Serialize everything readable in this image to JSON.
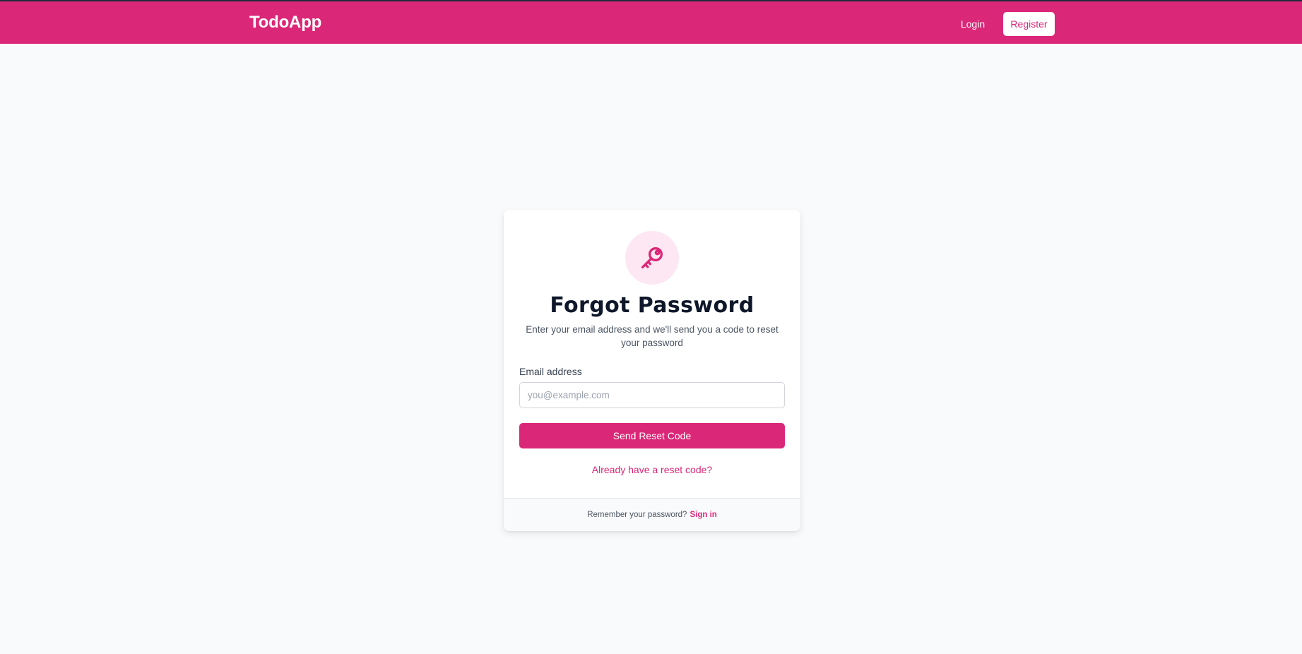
{
  "colors": {
    "brand": "#db2777",
    "icon_bg": "#fce7f3",
    "page_bg": "#f9fafb"
  },
  "navbar": {
    "brand": "TodoApp",
    "login_label": "Login",
    "register_label": "Register"
  },
  "card": {
    "icon": "key-icon",
    "title": "Forgot Password",
    "subtitle": "Enter your email address and we'll send you a code to reset your password",
    "email_label": "Email address",
    "email_placeholder": "you@example.com",
    "email_value": "",
    "send_button_label": "Send Reset Code",
    "reset_code_link": "Already have a reset code?",
    "footer_prompt": "Remember your password?",
    "footer_link": "Sign in"
  }
}
